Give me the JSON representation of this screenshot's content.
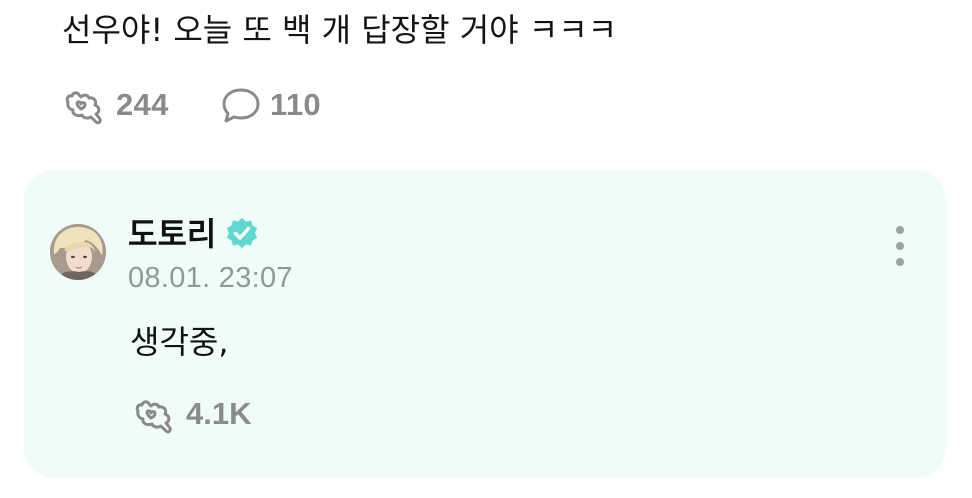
{
  "post": {
    "text": "선우야! 오늘 또 백 개 답장할 거야 ㅋㅋㅋ",
    "likes": "244",
    "comments": "110"
  },
  "reply": {
    "author": "도토리",
    "verified": true,
    "timestamp": "08.01. 23:07",
    "text": "생각중,",
    "likes": "4.1K"
  },
  "colors": {
    "card_background": "#effcf8",
    "verified_badge": "#5fd9d0",
    "muted_text": "#8a8a8a"
  },
  "icons": {
    "like": "hand-heart-icon",
    "comment": "speech-bubble-icon",
    "verified": "verified-badge-icon",
    "more": "more-vertical-icon"
  }
}
